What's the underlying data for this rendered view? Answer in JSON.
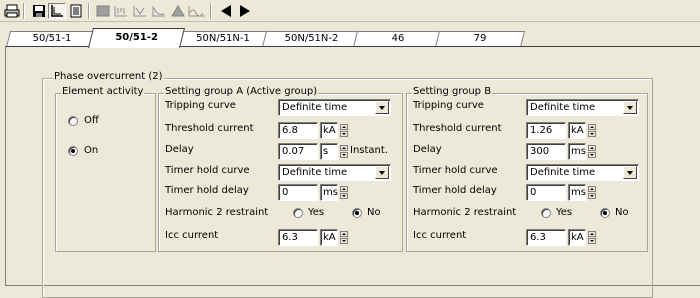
{
  "toolbar": {
    "icons": [
      "print-icon",
      "save-icon",
      "chart-icon",
      "document-icon",
      "block-icon",
      "curve-a-icon",
      "curve-b-icon",
      "curve-c-icon",
      "triangle-icon",
      "wave-icon",
      "arrow-left-icon",
      "arrow-right-icon"
    ]
  },
  "tabs": [
    {
      "label": "50/51-1"
    },
    {
      "label": "50/51-2"
    },
    {
      "label": "50N/51N-1"
    },
    {
      "label": "50N/51N-2"
    },
    {
      "label": "46"
    },
    {
      "label": "79"
    }
  ],
  "phase_frame": {
    "title": "Phase overcurrent (2)"
  },
  "element_activity": {
    "title": "Element activity",
    "off_label": "Off",
    "on_label": "On",
    "selected": "On"
  },
  "group_a": {
    "title": "Setting group A (Active group)",
    "tripping_curve_label": "Tripping curve",
    "tripping_curve_value": "Definite time",
    "threshold_label": "Threshold current",
    "threshold_value": "6.8",
    "threshold_unit": "kA",
    "delay_label": "Delay",
    "delay_value": "0.07",
    "delay_unit": "s",
    "delay_note": "Instant.",
    "timer_curve_label": "Timer hold curve",
    "timer_curve_value": "Definite time",
    "timer_delay_label": "Timer hold delay",
    "timer_delay_value": "0",
    "timer_delay_unit": "ms",
    "harmonic_label": "Harmonic 2 restraint",
    "yes_label": "Yes",
    "no_label": "No",
    "harmonic_selected": "No",
    "icc_label": "Icc current",
    "icc_value": "6.3",
    "icc_unit": "kA"
  },
  "group_b": {
    "title": "Setting group B",
    "tripping_curve_label": "Tripping curve",
    "tripping_curve_value": "Definite time",
    "threshold_label": "Threshold current",
    "threshold_value": "1.26",
    "threshold_unit": "kA",
    "delay_label": "Delay",
    "delay_value": "300",
    "delay_unit": "ms",
    "timer_curve_label": "Timer hold curve",
    "timer_curve_value": "Definite time",
    "timer_delay_label": "Timer hold delay",
    "timer_delay_value": "0",
    "timer_delay_unit": "ms",
    "harmonic_label": "Harmonic 2 restraint",
    "yes_label": "Yes",
    "no_label": "No",
    "harmonic_selected": "No",
    "icc_label": "Icc current",
    "icc_value": "6.3",
    "icc_unit": "kA"
  }
}
